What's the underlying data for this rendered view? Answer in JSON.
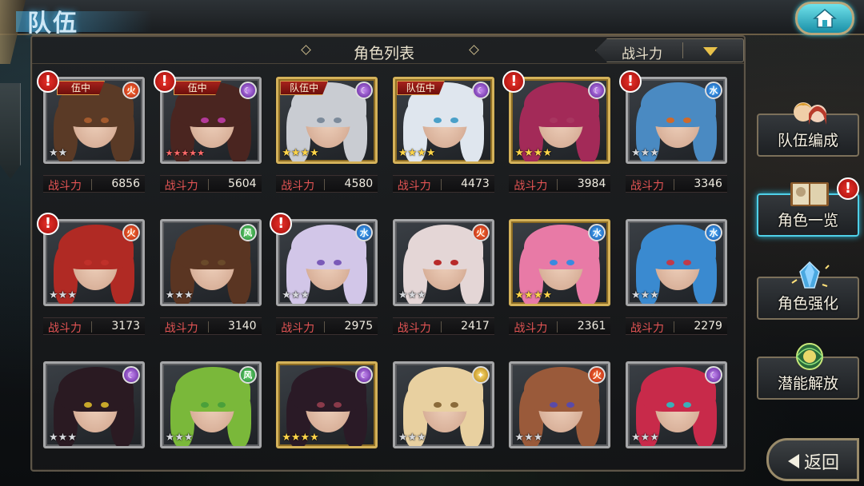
{
  "header": {
    "title": "队伍",
    "home_icon": "home-icon"
  },
  "panel": {
    "title": "角色列表",
    "sort_label": "战斗力",
    "power_label": "战斗力"
  },
  "characters": [
    {
      "power": "6856",
      "element": "fire",
      "stars": 2,
      "star_style": "silver",
      "frame": "silver",
      "in_team": true,
      "team_label": "伍中",
      "alert": true,
      "hair": "#5a3a26",
      "eye": "#a45b2e"
    },
    {
      "power": "5604",
      "element": "dark",
      "stars": 5,
      "star_style": "red",
      "frame": "silver",
      "in_team": true,
      "team_label": "伍中",
      "alert": true,
      "hair": "#4a2520",
      "eye": "#b33a9a"
    },
    {
      "power": "4580",
      "element": "dark",
      "stars": 4,
      "star_style": "gold",
      "frame": "gold",
      "in_team": true,
      "team_label": "队伍中",
      "alert": false,
      "hair": "#c9ccd2",
      "eye": "#7c8a9a"
    },
    {
      "power": "4473",
      "element": "dark",
      "stars": 4,
      "star_style": "gold",
      "frame": "gold",
      "in_team": true,
      "team_label": "队伍中",
      "alert": false,
      "hair": "#dfe6ee",
      "eye": "#4aa0c8"
    },
    {
      "power": "3984",
      "element": "dark",
      "stars": 4,
      "star_style": "gold",
      "frame": "gold",
      "in_team": false,
      "team_label": "",
      "alert": true,
      "hair": "#a32a58",
      "eye": "#a83660"
    },
    {
      "power": "3346",
      "element": "water",
      "stars": 3,
      "star_style": "silver",
      "frame": "silver",
      "in_team": false,
      "team_label": "",
      "alert": true,
      "hair": "#4a8ac2",
      "eye": "#d06a2a"
    },
    {
      "power": "3173",
      "element": "fire",
      "stars": 3,
      "star_style": "silver",
      "frame": "silver",
      "in_team": false,
      "team_label": "",
      "alert": true,
      "hair": "#b02a24",
      "eye": "#c0302a"
    },
    {
      "power": "3140",
      "element": "wind",
      "stars": 3,
      "star_style": "silver",
      "frame": "silver",
      "in_team": false,
      "team_label": "",
      "alert": false,
      "hair": "#5a3522",
      "eye": "#6a4a2a"
    },
    {
      "power": "2975",
      "element": "water",
      "stars": 3,
      "star_style": "silver",
      "frame": "silver",
      "in_team": false,
      "team_label": "",
      "alert": true,
      "hair": "#d2c6e8",
      "eye": "#7a5ab8"
    },
    {
      "power": "2417",
      "element": "fire",
      "stars": 3,
      "star_style": "silver",
      "frame": "silver",
      "in_team": false,
      "team_label": "",
      "alert": false,
      "hair": "#e4d6d6",
      "eye": "#b82a2a"
    },
    {
      "power": "2361",
      "element": "water",
      "stars": 4,
      "star_style": "gold",
      "frame": "gold",
      "in_team": false,
      "team_label": "",
      "alert": false,
      "hair": "#e87aa6",
      "eye": "#3a8ae0"
    },
    {
      "power": "2279",
      "element": "water",
      "stars": 3,
      "star_style": "silver",
      "frame": "silver",
      "in_team": false,
      "team_label": "",
      "alert": false,
      "hair": "#3a8ad0",
      "eye": "#c03a4a"
    },
    {
      "power": "",
      "element": "dark",
      "stars": 3,
      "star_style": "silver",
      "frame": "silver",
      "in_team": false,
      "team_label": "",
      "alert": false,
      "hair": "#2a1a22",
      "eye": "#c8a82a"
    },
    {
      "power": "",
      "element": "wind",
      "stars": 3,
      "star_style": "silver",
      "frame": "silver",
      "in_team": false,
      "team_label": "",
      "alert": false,
      "hair": "#7ab83a",
      "eye": "#4aa03a"
    },
    {
      "power": "",
      "element": "dark",
      "stars": 4,
      "star_style": "gold",
      "frame": "gold",
      "in_team": false,
      "team_label": "",
      "alert": false,
      "hair": "#2a1a26",
      "eye": "#8a3a4a"
    },
    {
      "power": "",
      "element": "light",
      "stars": 3,
      "star_style": "silver",
      "frame": "silver",
      "in_team": false,
      "team_label": "",
      "alert": false,
      "hair": "#e8d0a0",
      "eye": "#8a6a3a"
    },
    {
      "power": "",
      "element": "fire",
      "stars": 3,
      "star_style": "silver",
      "frame": "silver",
      "in_team": false,
      "team_label": "",
      "alert": false,
      "hair": "#9a5a3a",
      "eye": "#5a4aa8"
    },
    {
      "power": "",
      "element": "dark",
      "stars": 3,
      "star_style": "silver",
      "frame": "silver",
      "in_team": false,
      "team_label": "",
      "alert": false,
      "hair": "#c82a4a",
      "eye": "#3ab0b8"
    }
  ],
  "side_menu": [
    {
      "id": "side-team",
      "label": "队伍编成",
      "icon": "team-portraits-icon",
      "active": false
    },
    {
      "id": "side-list",
      "label": "角色一览",
      "icon": "book-icon",
      "active": true
    },
    {
      "id": "side-enhance",
      "label": "角色强化",
      "icon": "enhance-crystal-icon",
      "active": false
    },
    {
      "id": "side-potential",
      "label": "潜能解放",
      "icon": "potential-orb-icon",
      "active": false
    }
  ],
  "back_button": {
    "label": "返回"
  },
  "alert_mark": "!",
  "element_glyphs": {
    "fire": "火",
    "dark": "☾",
    "water": "水",
    "wind": "风",
    "light": "✦"
  },
  "colors": {
    "accent": "#4fd0e8",
    "power_label": "#e35454",
    "alert": "#e8312a",
    "star_gold": "#ffd54a"
  }
}
